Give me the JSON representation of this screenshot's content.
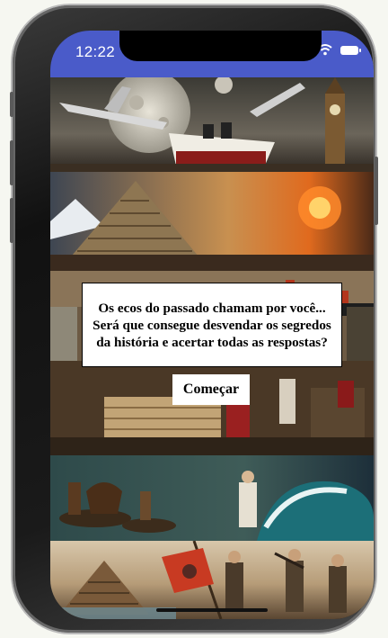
{
  "status_bar": {
    "time": "12:22",
    "background": "#4a5bc9"
  },
  "intro": {
    "message": "Os ecos do passado chamam por você... Será que consegue desvendar os segredos da história e acertar todas as respostas?",
    "start_label": "Começar"
  },
  "icons": [
    "wifi-icon",
    "battery-icon"
  ]
}
